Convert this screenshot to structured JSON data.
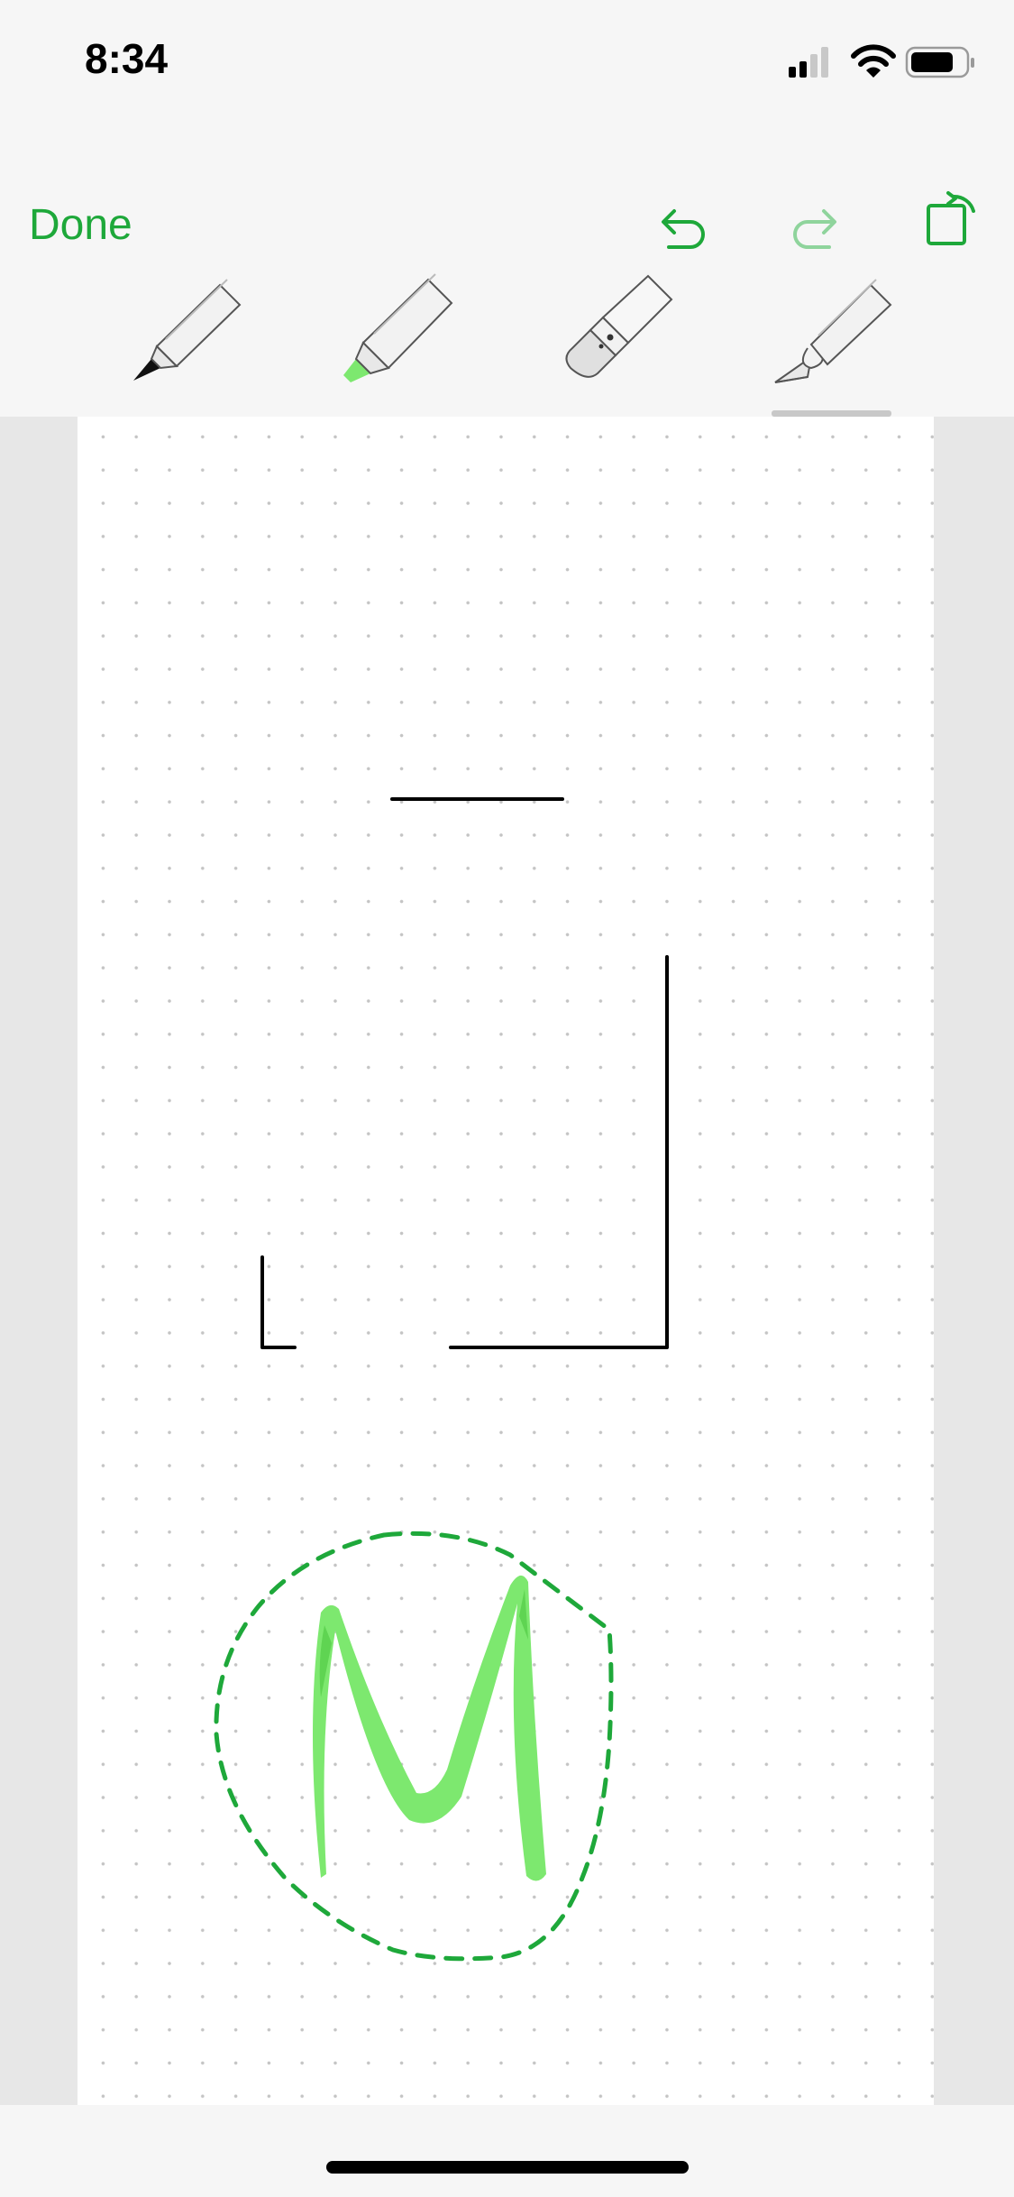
{
  "status_bar": {
    "time": "8:34",
    "icons": [
      "cellular-signal-icon",
      "wifi-icon",
      "battery-icon"
    ]
  },
  "toolbar": {
    "done_label": "Done",
    "actions": [
      "undo-icon",
      "redo-icon",
      "rotate-icon"
    ],
    "tools": [
      {
        "name": "pen",
        "icon": "pen-icon",
        "selected": false
      },
      {
        "name": "highlighter",
        "icon": "highlighter-icon",
        "selected": false
      },
      {
        "name": "eraser",
        "icon": "eraser-icon",
        "selected": false
      },
      {
        "name": "lasso",
        "icon": "lasso-cutter-icon",
        "selected": true
      }
    ]
  },
  "canvas": {
    "background": "dot-grid",
    "strokes": [
      {
        "type": "line",
        "color": "#000000"
      },
      {
        "type": "corner-bracket",
        "color": "#000000"
      },
      {
        "type": "small-corner",
        "color": "#000000"
      },
      {
        "type": "letter-m-highlighter",
        "color": "#7de86f"
      }
    ],
    "selection": {
      "type": "lasso-dashed",
      "color": "#1ea83a"
    }
  },
  "colors": {
    "accent": "#1ea83a",
    "highlighter": "#7de86f",
    "ink": "#000000"
  }
}
